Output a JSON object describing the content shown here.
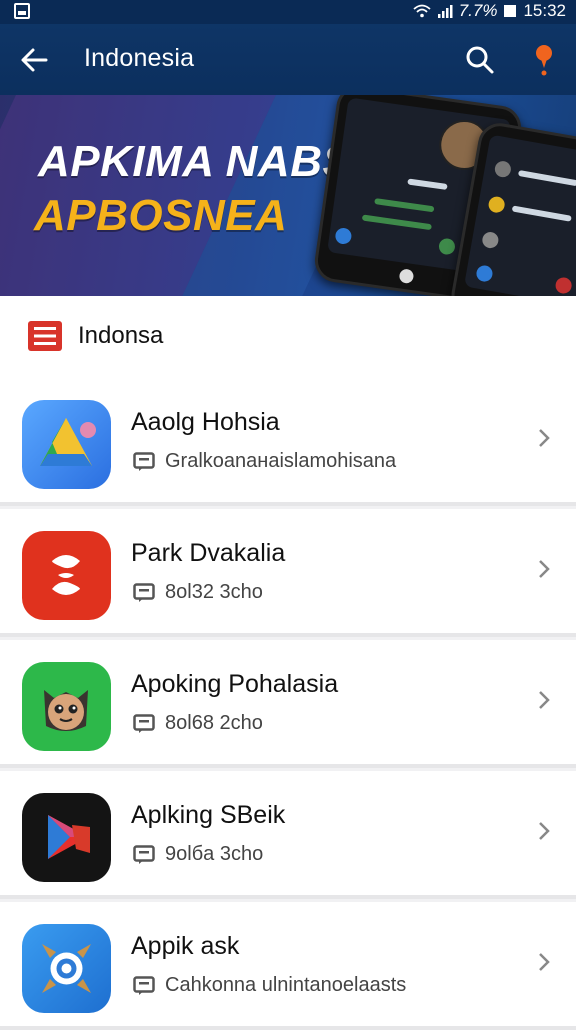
{
  "status_bar": {
    "battery_text": "7.7%",
    "time": "15:32"
  },
  "app_bar": {
    "title": "Indonesia",
    "back_icon": "arrow-left-icon",
    "search_icon": "search-icon",
    "notification_icon": "notification-pin-icon",
    "background": "#0e3566"
  },
  "banner": {
    "line1": "APKIMA NABSIA",
    "line2": "APBOSNEA",
    "line1_color": "#ffffff",
    "line2_color": "#f5b21a"
  },
  "section": {
    "icon": "list-icon",
    "label": "Indonsa",
    "icon_color": "#d8342a"
  },
  "apps": [
    {
      "name": "Aaolg Hohsia",
      "subtitle": "Gralkoanaнaislamohisana",
      "icon": "drive-triangle-icon"
    },
    {
      "name": "Park Dvakalia",
      "subtitle": "8ol32 3cho",
      "icon": "red-swirl-icon"
    },
    {
      "name": "Apoking Pohalasia",
      "subtitle": "8ol68 2cho",
      "icon": "owl-face-icon"
    },
    {
      "name": "Aplking SBeik",
      "subtitle": "9olбa 3cho",
      "icon": "play-triangle-icon"
    },
    {
      "name": "Appik ask",
      "subtitle": "Cahkonna ulnintanoelaasts",
      "icon": "target-arrows-icon"
    }
  ]
}
